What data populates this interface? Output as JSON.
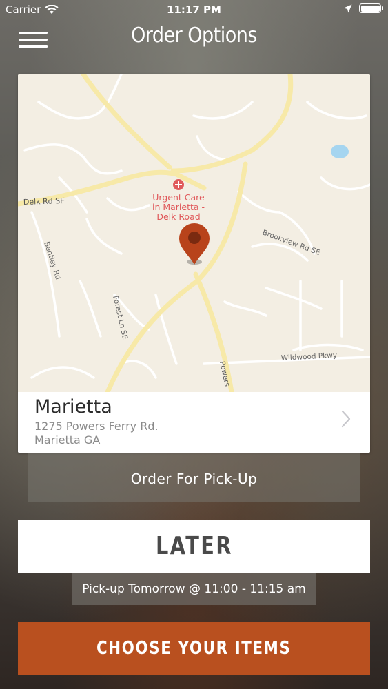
{
  "status_bar": {
    "carrier": "Carrier",
    "time": "11:17 PM"
  },
  "header": {
    "title": "Order Options"
  },
  "map": {
    "labels": {
      "road_delk": "Delk Rd SE",
      "poi_line1": "Urgent Care",
      "poi_line2": "in Marietta -",
      "poi_line3": "Delk Road",
      "road_brookview": "Brookview Rd SE",
      "road_bentley": "Bentley Rd",
      "road_forest": "Forest Ln SE",
      "road_wildwood": "Wildwood Pkwy",
      "road_powers": "Powers"
    },
    "colors": {
      "background": "#f3eee3",
      "major_road": "#f7e9a8",
      "minor_road": "#ffffff",
      "water": "#a5d5f0",
      "pin": "#b8431b",
      "poi": "#e0595b"
    }
  },
  "location": {
    "name": "Marietta",
    "address_line1": "1275 Powers Ferry Rd.",
    "address_line2": "Marietta GA"
  },
  "order_type": {
    "label": "Order For Pick-Up"
  },
  "timing": {
    "button_label": "LATER",
    "pickup_time": "Pick-up Tomorrow @ 11:00 - 11:15 am"
  },
  "cta": {
    "label": "CHOOSE YOUR ITEMS",
    "color": "#b9501f"
  }
}
